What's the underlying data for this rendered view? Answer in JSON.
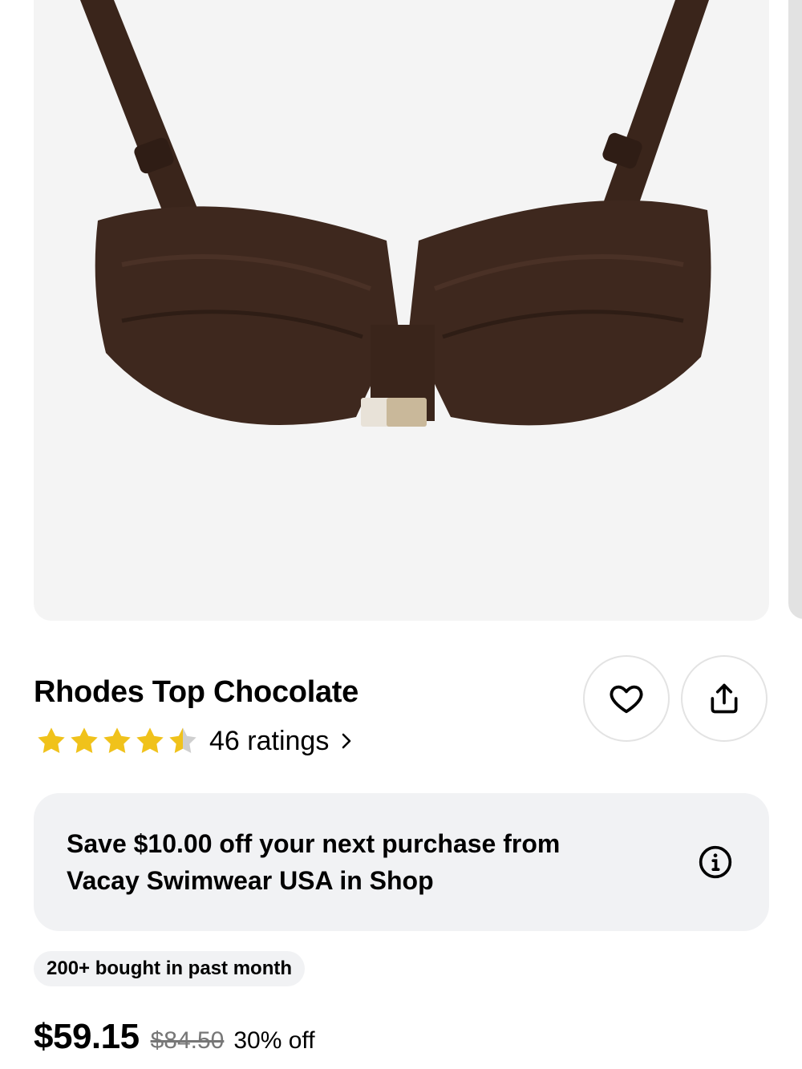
{
  "product": {
    "title": "Rhodes Top Chocolate",
    "rating": 4.5,
    "rating_max": 5,
    "ratings_label": "46 ratings",
    "image_alt": "Chocolate brown underwire bikini top",
    "colors": {
      "garment": "#3c261c",
      "star": "#f0c21b",
      "star_empty": "#cfcfcf"
    }
  },
  "actions": {
    "favorite_icon": "heart-icon",
    "share_icon": "share-icon"
  },
  "promo": {
    "text": "Save $10.00 off your next purchase from Vacay Swimwear USA in Shop",
    "icon": "info-icon"
  },
  "badge": {
    "text": "200+ bought in past month"
  },
  "pricing": {
    "price": "$59.15",
    "original_price": "$84.50",
    "discount": "30% off"
  }
}
